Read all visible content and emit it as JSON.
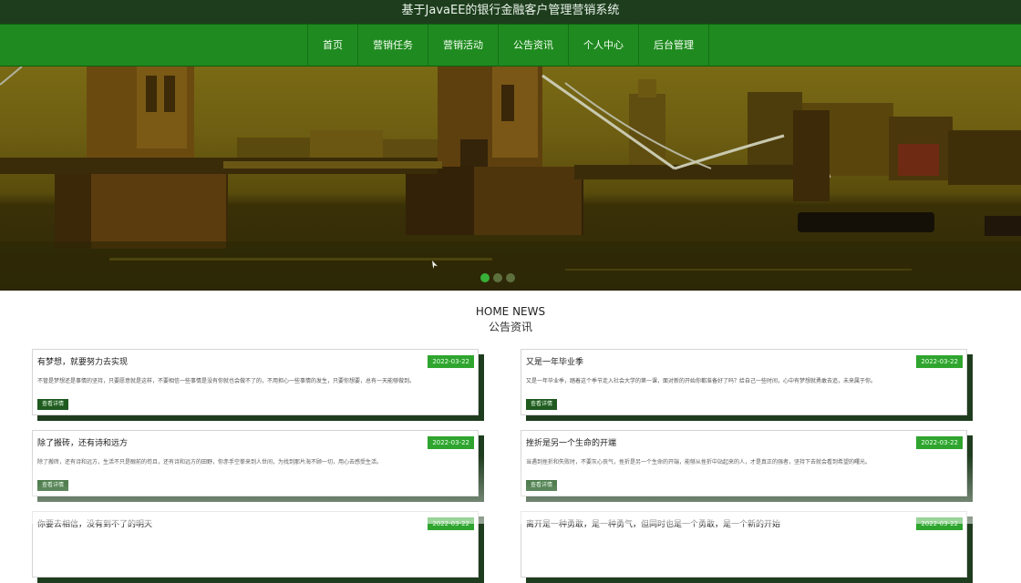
{
  "header": {
    "site_title": "基于JavaEE的银行金融客户管理营销系统"
  },
  "nav": {
    "items": [
      {
        "label": "首页"
      },
      {
        "label": "营销任务"
      },
      {
        "label": "营销活动"
      },
      {
        "label": "公告资讯"
      },
      {
        "label": "个人中心"
      },
      {
        "label": "后台管理"
      }
    ]
  },
  "carousel": {
    "slide_count": 3,
    "active_index": 0
  },
  "news_section": {
    "title_en": "HOME NEWS",
    "title_cn": "公告资讯",
    "items": [
      {
        "title": "有梦想，就要努力去实现",
        "date": "2022-03-22",
        "summary": "不管是梦想还是事情的坚持，只要愿意就是这样，不要相信一些事情是没有你就也会做不了的，不用担心一些事情的发生，只要你想要，总有一天能够做到。",
        "more": "查看详情"
      },
      {
        "title": "又是一年毕业季",
        "date": "2022-03-22",
        "summary": "又是一年毕业季，踏着这个季节走入社会大学的第一课，面对新的开始你都准备好了吗？给自己一些时间，心中有梦想就勇敢去追，未来属于你。",
        "more": "查看详情"
      },
      {
        "title": "除了搬砖，还有诗和远方",
        "date": "2022-03-22",
        "summary": "除了搬砖，还有诗和远方，生活不只是眼前的苟且，还有诗和远方的田野，你赤手空拳来到人世间，为找到那片海不顾一切，用心去感受生活。",
        "more": "查看详情"
      },
      {
        "title": "挫折是另一个生命的开端",
        "date": "2022-03-22",
        "summary": "当遇到挫折和失败时，不要灰心丧气，挫折是另一个生命的开端，能够从挫折中站起来的人，才是真正的强者，坚持下去就会看到希望的曙光。",
        "more": "查看详情"
      },
      {
        "title": "你要去相信，没有到不了的明天",
        "date": "2022-03-22"
      },
      {
        "title": "离开是一种勇敢，是一种勇气，但同时也是一个勇敢，是一个新的开始",
        "date": "2022-03-22"
      }
    ]
  },
  "colors": {
    "topbar": "#1d3d1d",
    "nav": "#1f8a1f",
    "accent": "#2fa52f",
    "dark_green": "#1f5a1f"
  }
}
